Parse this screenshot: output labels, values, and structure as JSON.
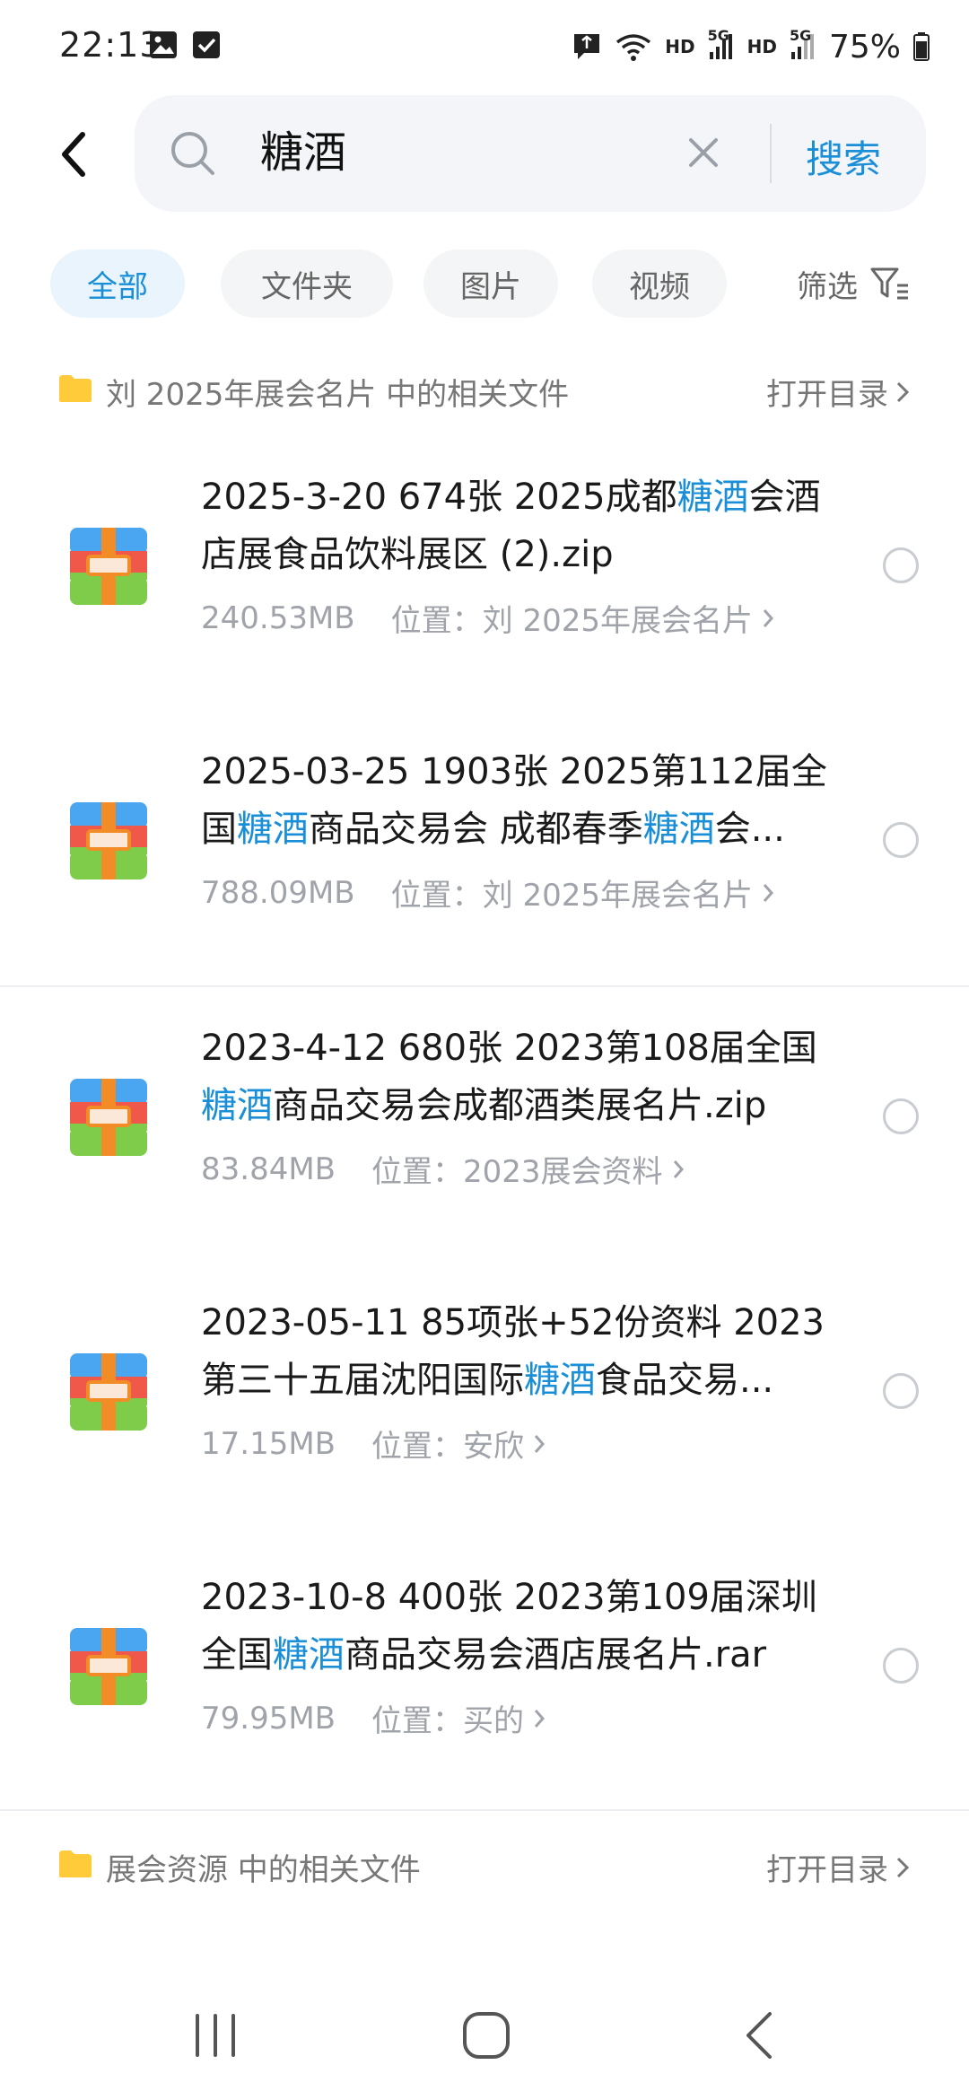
{
  "status": {
    "time": "22:13",
    "hd1": "HD",
    "hd2": "HD",
    "sig1": "5G",
    "sig2": "5G",
    "battery": "75%"
  },
  "search": {
    "query": "糖酒",
    "button_label": "搜索"
  },
  "tabs": [
    {
      "label": "全部",
      "active": true
    },
    {
      "label": "文件夹",
      "active": false
    },
    {
      "label": "图片",
      "active": false
    },
    {
      "label": "视频",
      "active": false
    }
  ],
  "filter_label": "筛选",
  "groups": [
    {
      "title": "刘 2025年展会名片 中的相关文件",
      "open_label": "打开目录"
    },
    {
      "title": "展会资源 中的相关文件",
      "open_label": "打开目录"
    }
  ],
  "highlight_color": "#1a8fd8",
  "files": [
    {
      "title_parts": [
        {
          "text": "2025-3-20 674张 2025成都",
          "hl": false
        },
        {
          "text": "糖酒",
          "hl": true
        },
        {
          "text": "会酒店展食品饮料展区 (2).zip",
          "hl": false
        }
      ],
      "size": "240.53MB",
      "location": "位置：刘 2025年展会名片"
    },
    {
      "title_parts": [
        {
          "text": "2025-03-25 1903张 2025第112届全国",
          "hl": false
        },
        {
          "text": "糖酒",
          "hl": true
        },
        {
          "text": "商品交易会 成都春季",
          "hl": false
        },
        {
          "text": "糖酒",
          "hl": true
        },
        {
          "text": "会...",
          "hl": false
        }
      ],
      "size": "788.09MB",
      "location": "位置：刘 2025年展会名片"
    },
    {
      "title_parts": [
        {
          "text": "2023-4-12 680张 2023第108届全国",
          "hl": false
        },
        {
          "text": "糖酒",
          "hl": true
        },
        {
          "text": "商品交易会成都酒类展名片.zip",
          "hl": false
        }
      ],
      "size": "83.84MB",
      "location": "位置：2023展会资料"
    },
    {
      "title_parts": [
        {
          "text": "2023-05-11 85项张+52份资料 2023第三十五届沈阳国际",
          "hl": false
        },
        {
          "text": "糖酒",
          "hl": true
        },
        {
          "text": "食品交易...",
          "hl": false
        }
      ],
      "size": "17.15MB",
      "location": "位置：安欣"
    },
    {
      "title_parts": [
        {
          "text": "2023-10-8 400张 2023第109届深圳全国",
          "hl": false
        },
        {
          "text": "糖酒",
          "hl": true
        },
        {
          "text": "商品交易会酒店展名片.rar",
          "hl": false
        }
      ],
      "size": "79.95MB",
      "location": "位置：买的"
    }
  ]
}
